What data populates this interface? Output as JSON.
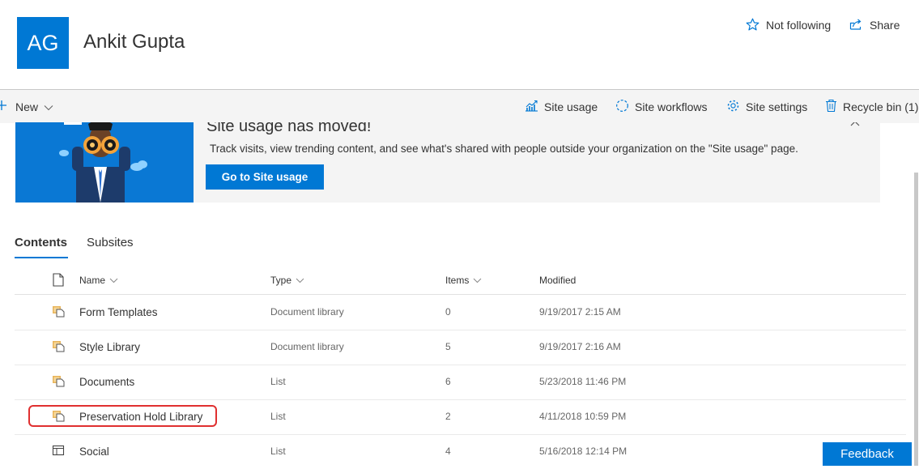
{
  "site": {
    "logo_initials": "AG",
    "title": "Ankit Gupta"
  },
  "header": {
    "follow_label": "Not following",
    "share_label": "Share"
  },
  "command_bar": {
    "new_label": "New",
    "site_usage_label": "Site usage",
    "site_workflows_label": "Site workflows",
    "site_settings_label": "Site settings",
    "recycle_bin_label": "Recycle bin (1)"
  },
  "banner": {
    "title": "Site usage has moved!",
    "text": "Track visits, view trending content, and see what's shared with people outside your organization on the \"Site usage\" page.",
    "button_label": "Go to Site usage"
  },
  "tabs": [
    {
      "label": "Contents",
      "active": true
    },
    {
      "label": "Subsites",
      "active": false
    }
  ],
  "table": {
    "columns": {
      "name": "Name",
      "type": "Type",
      "items": "Items",
      "modified": "Modified"
    },
    "rows": [
      {
        "icon": "library-icon",
        "name": "Form Templates",
        "type": "Document library",
        "items": "0",
        "modified": "9/19/2017 2:15 AM"
      },
      {
        "icon": "library-icon",
        "name": "Style Library",
        "type": "Document library",
        "items": "5",
        "modified": "9/19/2017 2:16 AM"
      },
      {
        "icon": "library-icon",
        "name": "Documents",
        "type": "List",
        "items": "6",
        "modified": "5/23/2018 11:46 PM"
      },
      {
        "icon": "library-icon",
        "name": "Preservation Hold Library",
        "type": "List",
        "items": "2",
        "modified": "4/11/2018 10:59 PM"
      },
      {
        "icon": "list-table-icon",
        "name": "Social",
        "type": "List",
        "items": "4",
        "modified": "5/16/2018 12:14 PM"
      }
    ]
  },
  "feedback_label": "Feedback",
  "colors": {
    "accent": "#0078d4",
    "highlight": "#e03030",
    "command_bar_bg": "#f4f4f4"
  }
}
